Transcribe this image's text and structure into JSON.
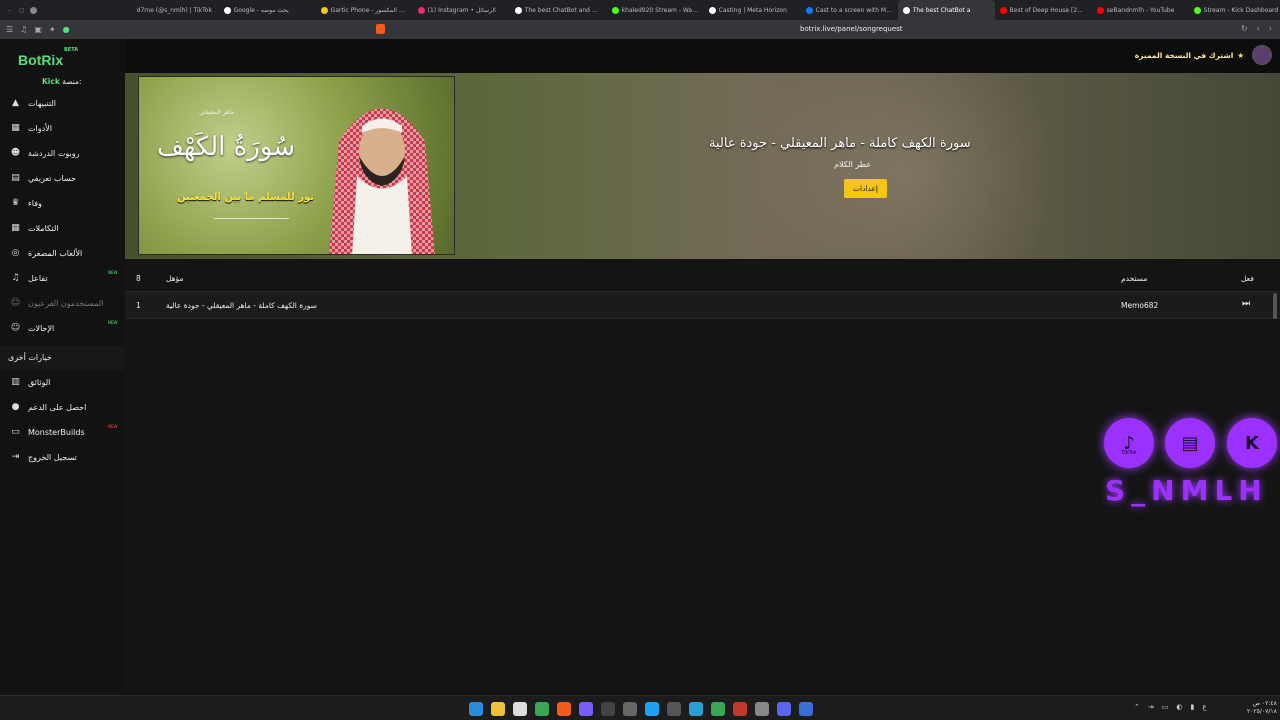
{
  "browser": {
    "tabs": [
      {
        "title": "",
        "color": "#888"
      },
      {
        "title": "d7me (@s_nmlh) | TikTok",
        "color": "#222"
      },
      {
        "title": "Google - بحث موضه",
        "color": "#fff"
      },
      {
        "title": "Gartic Phone - الهاتف المكسور",
        "color": "#f5c518"
      },
      {
        "title": "(1) Instagram • الرسائل",
        "color": "#e1306c"
      },
      {
        "title": "The best ChatBot and Widgets",
        "color": "#fff"
      },
      {
        "title": "khaled920 Stream - Watch",
        "color": "#53fc18"
      },
      {
        "title": "Casting | Meta Horizon",
        "color": "#fff"
      },
      {
        "title": "Cast to a screen with Meta",
        "color": "#1877f2"
      },
      {
        "title": "The best ChatBot a",
        "color": "#fff",
        "active": true
      },
      {
        "title": "Best of Deep House [2025]",
        "color": "#ff0000"
      },
      {
        "title": "seBandnmlh - YouTube",
        "color": "#ff0000"
      },
      {
        "title": "Stream - Kick Dashboard",
        "color": "#53fc18"
      }
    ],
    "url": "botrix.live/panel/songrequest"
  },
  "app": {
    "logo": "BotRix",
    "beta": "BETA",
    "platform_label": "منصة:",
    "platform_value": "Kick",
    "premium_cta": "اشترك في النسخة المميزة"
  },
  "sidebar": {
    "items": [
      {
        "label": "التنبيهات",
        "icon": "warning-icon"
      },
      {
        "label": "الأدوات",
        "icon": "tools-icon"
      },
      {
        "label": "روبوت الدردشة",
        "icon": "robot-icon"
      },
      {
        "label": "حساب تعريفي",
        "icon": "profile-card-icon"
      },
      {
        "label": "وفاء",
        "icon": "trophy-icon"
      },
      {
        "label": "التكاملات",
        "icon": "grid-icon"
      },
      {
        "label": "الألعاب المصغرة",
        "icon": "gamepad-icon"
      },
      {
        "label": "تفاعل",
        "icon": "music-icon",
        "badge": "NEW"
      },
      {
        "label": "المستخدمون الفرعيون",
        "icon": "users-icon",
        "disabled": true
      },
      {
        "label": "الإحالات",
        "icon": "referral-icon",
        "badge": "NEW"
      }
    ],
    "other_header": "خيارات أخرى",
    "other_items": [
      {
        "label": "الوثائق",
        "icon": "docs-icon"
      },
      {
        "label": "احصل على الدعم",
        "icon": "help-icon"
      },
      {
        "label": "MonsterBuilds",
        "icon": "monitor-icon",
        "badge": "NEW"
      },
      {
        "label": "تسجيل الخروج",
        "icon": "logout-icon"
      }
    ]
  },
  "banner": {
    "song_title": "سورة الكهف كاملة - ماهر المعيقلي - جودة عالية",
    "channel": "عطر الكلام",
    "settings_button": "إعدادات",
    "thumb_caption_main": "سُورَةُ الكَهْف",
    "thumb_caption_sub": "نور للمسلم ما بين الجمعتين",
    "thumb_caption_top": "ماهر المعيقلي"
  },
  "queue": {
    "headers": {
      "count": "8",
      "title": "مؤهل",
      "user": "مستخدم",
      "action": "فعل"
    },
    "rows": [
      {
        "index": "1",
        "title": "سورة الكهف كاملة - ماهر المعيقلي - جودة عالية",
        "user": "Memo682"
      }
    ]
  },
  "overlay": {
    "name": "S_NMLH",
    "tiktok_label": "TikTok",
    "colors": {
      "accent": "#9b30ff"
    }
  },
  "taskbar": {
    "clock_time": "٠٢:٤٨ ص",
    "clock_date": "٢٠٢٥/٠٧/١٨"
  }
}
